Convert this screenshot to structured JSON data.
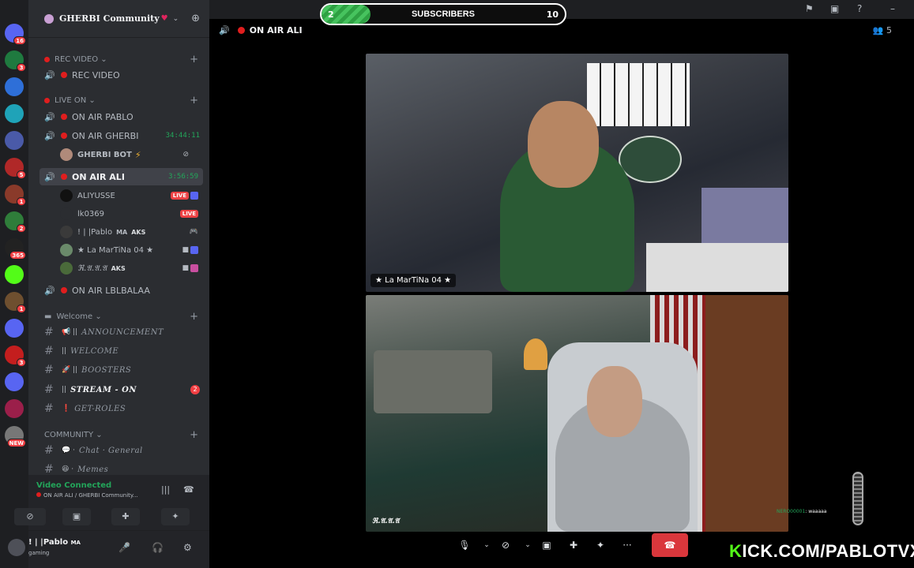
{
  "rail": {
    "servers": [
      {
        "name": "discord-home",
        "badge": "16",
        "color": "#5865f2"
      },
      {
        "name": "server-2",
        "badge": "3",
        "color": "#1f7a3f"
      },
      {
        "name": "server-3",
        "badge": "",
        "color": "#2e6fd8"
      },
      {
        "name": "server-4",
        "badge": "",
        "color": "#1fa3b8"
      },
      {
        "name": "server-5",
        "badge": "",
        "color": "#4a5aa8"
      },
      {
        "name": "server-6",
        "badge": "5",
        "color": "#b02828"
      },
      {
        "name": "server-7",
        "badge": "1",
        "color": "#8a3a2a"
      },
      {
        "name": "server-8",
        "badge": "2",
        "color": "#2f7d3a"
      },
      {
        "name": "server-9",
        "badge": "365",
        "color": "#222"
      },
      {
        "name": "server-10",
        "badge": "",
        "color": "#53fc18"
      },
      {
        "name": "server-11",
        "badge": "1",
        "color": "#6e4f2f"
      },
      {
        "name": "server-12",
        "badge": "",
        "color": "#5865f2"
      },
      {
        "name": "server-13",
        "badge": "3",
        "color": "#c41e1e"
      },
      {
        "name": "server-14",
        "badge": "",
        "color": "#5865f2"
      },
      {
        "name": "server-15",
        "badge": "",
        "color": "#9b1f4a"
      },
      {
        "name": "server-16",
        "badge": "NEW",
        "color": "#777"
      }
    ]
  },
  "server": {
    "name": "GHERBI Community",
    "heart": "♥"
  },
  "categories": {
    "rec_video": "REC VIDEO",
    "live_on": "LIVE ON",
    "welcome": "Welcome",
    "community": "COMMUNITY"
  },
  "voice": {
    "rec_video": "REC VIDEO",
    "on_air_pablo": "ON AIR PABLO",
    "on_air_gherbi": "ON AIR GHERBI",
    "on_air_gherbi_time": "34:44:11",
    "on_air_ali": "ON AIR ALI",
    "on_air_ali_time": "3:56:59",
    "on_air_lblbalaa": "ON AIR LBLBALAA"
  },
  "members": {
    "gherbi_bot": "GHERBI BOT",
    "aliyusse": "ALIYUSSE",
    "lk0369": "lk0369",
    "pablo": "! | |Pablo",
    "pablo_tag": "MA",
    "pablo_badge": "AKS",
    "lamartina": "★ La MarTiNa 04 ★",
    "naaa": "ℜ.𝔄.𝔄.𝔄",
    "naaa_badge": "AKS",
    "live_label": "LIVE"
  },
  "text_channels": [
    {
      "label": "ANNOUNCEMENT",
      "prefix": "📢 ||"
    },
    {
      "label": "WELCOME",
      "prefix": "||"
    },
    {
      "label": "BOOSTERS",
      "prefix": "🚀 ||"
    },
    {
      "label": "STREAM - ON",
      "prefix": "||",
      "count": "2"
    },
    {
      "label": "GET-ROLES",
      "prefix": "❗"
    },
    {
      "label": "Chat · General",
      "prefix": "💬 ·"
    },
    {
      "label": "Memes",
      "prefix": "😆 ·"
    }
  ],
  "voice_panel": {
    "title": "Video Connected",
    "subtitle": "ON AIR ALI / GHERBI Community..."
  },
  "userbar": {
    "name": "! | |Pablo",
    "tag": "MA",
    "status": "gaming"
  },
  "main": {
    "channel": "ON AIR ALI",
    "member_count": "5"
  },
  "subs_goal": {
    "current": "2",
    "label": "SUBSCRIBERS",
    "goal": "10",
    "progress": 0.2
  },
  "tiles": {
    "tile1_name": "★ La MarTiNa 04 ★",
    "tile2_name": "ℜ.𝔄.𝔄.𝔄"
  },
  "chat_overlay": {
    "user": "NERO00001",
    "message": ": waaaaa"
  },
  "kick": {
    "prefix": "K",
    "rest": "ICK.COM/PABLOTVX"
  },
  "colors": {
    "accent_green": "#23a55a",
    "live_red": "#ed4245",
    "kick_green": "#53fc18"
  }
}
